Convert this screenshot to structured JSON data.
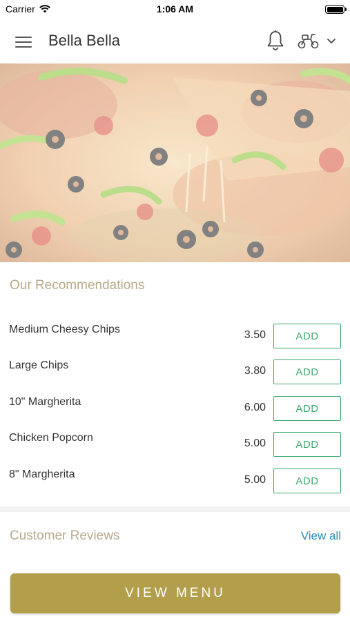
{
  "status_bar": {
    "carrier": "Carrier",
    "time": "1:06 AM"
  },
  "header": {
    "title": "Bella Bella",
    "icons": [
      "menu-icon",
      "bell-icon",
      "scooter-icon",
      "chevron-down-icon"
    ]
  },
  "recommendations": {
    "title": "Our Recommendations",
    "items": [
      {
        "name": "Medium Cheesy Chips",
        "price": "3.50",
        "add_label": "ADD"
      },
      {
        "name": "Large Chips",
        "price": "3.80",
        "add_label": "ADD"
      },
      {
        "name": "10\" Margherita",
        "price": "6.00",
        "add_label": "ADD"
      },
      {
        "name": "Chicken Popcorn",
        "price": "5.00",
        "add_label": "ADD"
      },
      {
        "name": "8\" Margherita",
        "price": "5.00",
        "add_label": "ADD"
      }
    ]
  },
  "reviews": {
    "title": "Customer Reviews",
    "view_all_label": "View all"
  },
  "footer": {
    "view_menu_label": "VIEW MENU"
  },
  "colors": {
    "accent_gold": "#b39f4b",
    "section_title": "#b8a98a",
    "add_green": "#3ca86a",
    "link_blue": "#2a8cc0"
  }
}
